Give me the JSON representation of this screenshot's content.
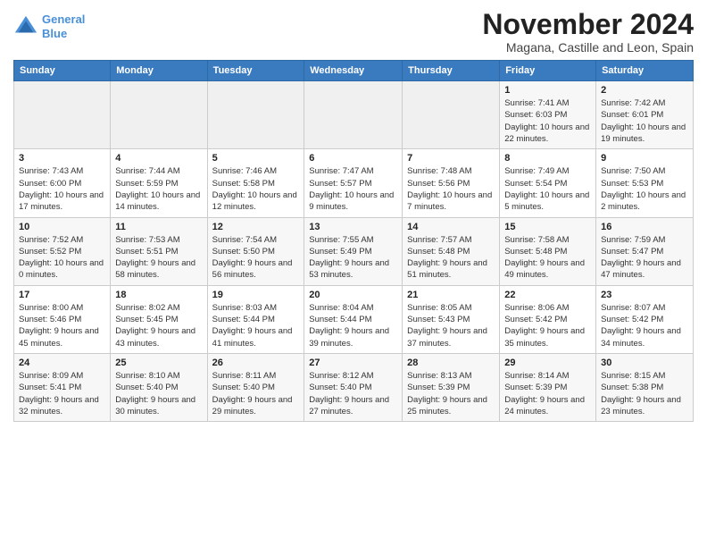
{
  "header": {
    "logo_line1": "General",
    "logo_line2": "Blue",
    "month_title": "November 2024",
    "location": "Magana, Castille and Leon, Spain"
  },
  "weekdays": [
    "Sunday",
    "Monday",
    "Tuesday",
    "Wednesday",
    "Thursday",
    "Friday",
    "Saturday"
  ],
  "weeks": [
    [
      {
        "day": "",
        "info": ""
      },
      {
        "day": "",
        "info": ""
      },
      {
        "day": "",
        "info": ""
      },
      {
        "day": "",
        "info": ""
      },
      {
        "day": "",
        "info": ""
      },
      {
        "day": "1",
        "info": "Sunrise: 7:41 AM\nSunset: 6:03 PM\nDaylight: 10 hours and 22 minutes."
      },
      {
        "day": "2",
        "info": "Sunrise: 7:42 AM\nSunset: 6:01 PM\nDaylight: 10 hours and 19 minutes."
      }
    ],
    [
      {
        "day": "3",
        "info": "Sunrise: 7:43 AM\nSunset: 6:00 PM\nDaylight: 10 hours and 17 minutes."
      },
      {
        "day": "4",
        "info": "Sunrise: 7:44 AM\nSunset: 5:59 PM\nDaylight: 10 hours and 14 minutes."
      },
      {
        "day": "5",
        "info": "Sunrise: 7:46 AM\nSunset: 5:58 PM\nDaylight: 10 hours and 12 minutes."
      },
      {
        "day": "6",
        "info": "Sunrise: 7:47 AM\nSunset: 5:57 PM\nDaylight: 10 hours and 9 minutes."
      },
      {
        "day": "7",
        "info": "Sunrise: 7:48 AM\nSunset: 5:56 PM\nDaylight: 10 hours and 7 minutes."
      },
      {
        "day": "8",
        "info": "Sunrise: 7:49 AM\nSunset: 5:54 PM\nDaylight: 10 hours and 5 minutes."
      },
      {
        "day": "9",
        "info": "Sunrise: 7:50 AM\nSunset: 5:53 PM\nDaylight: 10 hours and 2 minutes."
      }
    ],
    [
      {
        "day": "10",
        "info": "Sunrise: 7:52 AM\nSunset: 5:52 PM\nDaylight: 10 hours and 0 minutes."
      },
      {
        "day": "11",
        "info": "Sunrise: 7:53 AM\nSunset: 5:51 PM\nDaylight: 9 hours and 58 minutes."
      },
      {
        "day": "12",
        "info": "Sunrise: 7:54 AM\nSunset: 5:50 PM\nDaylight: 9 hours and 56 minutes."
      },
      {
        "day": "13",
        "info": "Sunrise: 7:55 AM\nSunset: 5:49 PM\nDaylight: 9 hours and 53 minutes."
      },
      {
        "day": "14",
        "info": "Sunrise: 7:57 AM\nSunset: 5:48 PM\nDaylight: 9 hours and 51 minutes."
      },
      {
        "day": "15",
        "info": "Sunrise: 7:58 AM\nSunset: 5:48 PM\nDaylight: 9 hours and 49 minutes."
      },
      {
        "day": "16",
        "info": "Sunrise: 7:59 AM\nSunset: 5:47 PM\nDaylight: 9 hours and 47 minutes."
      }
    ],
    [
      {
        "day": "17",
        "info": "Sunrise: 8:00 AM\nSunset: 5:46 PM\nDaylight: 9 hours and 45 minutes."
      },
      {
        "day": "18",
        "info": "Sunrise: 8:02 AM\nSunset: 5:45 PM\nDaylight: 9 hours and 43 minutes."
      },
      {
        "day": "19",
        "info": "Sunrise: 8:03 AM\nSunset: 5:44 PM\nDaylight: 9 hours and 41 minutes."
      },
      {
        "day": "20",
        "info": "Sunrise: 8:04 AM\nSunset: 5:44 PM\nDaylight: 9 hours and 39 minutes."
      },
      {
        "day": "21",
        "info": "Sunrise: 8:05 AM\nSunset: 5:43 PM\nDaylight: 9 hours and 37 minutes."
      },
      {
        "day": "22",
        "info": "Sunrise: 8:06 AM\nSunset: 5:42 PM\nDaylight: 9 hours and 35 minutes."
      },
      {
        "day": "23",
        "info": "Sunrise: 8:07 AM\nSunset: 5:42 PM\nDaylight: 9 hours and 34 minutes."
      }
    ],
    [
      {
        "day": "24",
        "info": "Sunrise: 8:09 AM\nSunset: 5:41 PM\nDaylight: 9 hours and 32 minutes."
      },
      {
        "day": "25",
        "info": "Sunrise: 8:10 AM\nSunset: 5:40 PM\nDaylight: 9 hours and 30 minutes."
      },
      {
        "day": "26",
        "info": "Sunrise: 8:11 AM\nSunset: 5:40 PM\nDaylight: 9 hours and 29 minutes."
      },
      {
        "day": "27",
        "info": "Sunrise: 8:12 AM\nSunset: 5:40 PM\nDaylight: 9 hours and 27 minutes."
      },
      {
        "day": "28",
        "info": "Sunrise: 8:13 AM\nSunset: 5:39 PM\nDaylight: 9 hours and 25 minutes."
      },
      {
        "day": "29",
        "info": "Sunrise: 8:14 AM\nSunset: 5:39 PM\nDaylight: 9 hours and 24 minutes."
      },
      {
        "day": "30",
        "info": "Sunrise: 8:15 AM\nSunset: 5:38 PM\nDaylight: 9 hours and 23 minutes."
      }
    ]
  ]
}
